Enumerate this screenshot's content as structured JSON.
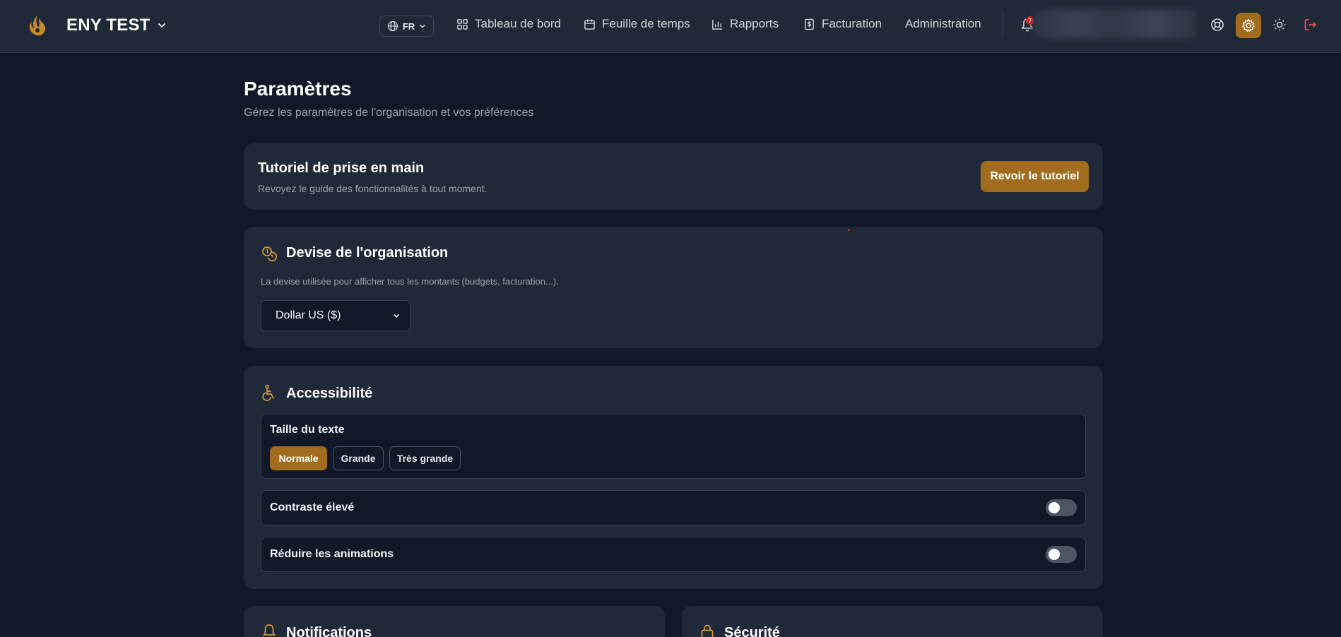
{
  "header": {
    "brand": "ENY TEST",
    "language": "FR",
    "nav": [
      {
        "label": "Tableau de bord",
        "icon": "grid-icon"
      },
      {
        "label": "Feuille de temps",
        "icon": "calendar-icon"
      },
      {
        "label": "Rapports",
        "icon": "bar-chart-icon"
      },
      {
        "label": "Facturation",
        "icon": "invoice-icon"
      },
      {
        "label": "Administration",
        "icon": ""
      }
    ],
    "notification_count": "7"
  },
  "page": {
    "title": "Paramètres",
    "subtitle": "Gérez les paramètres de l'organisation et vos préférences"
  },
  "tutorial": {
    "title": "Tutoriel de prise en main",
    "description": "Revoyez le guide des fonctionnalités à tout moment.",
    "button": "Revoir le tutoriel"
  },
  "currency": {
    "title": "Devise de l'organisation",
    "description": "La devise utilisée pour afficher tous les montants (budgets, facturation...).",
    "selected": "Dollar US ($)"
  },
  "accessibility": {
    "title": "Accessibilité",
    "text_size_label": "Taille du texte",
    "text_sizes": [
      "Normale",
      "Grande",
      "Très grande"
    ],
    "active_text_size": "Normale",
    "high_contrast_label": "Contraste élevé",
    "high_contrast_on": false,
    "reduce_motion_label": "Réduire les animations",
    "reduce_motion_on": false
  },
  "notifications": {
    "title": "Notifications"
  },
  "security": {
    "title": "Sécurité"
  },
  "colors": {
    "accent": "#a16c1e",
    "background": "#111827",
    "card": "#1f2937",
    "logout": "#f05252"
  }
}
